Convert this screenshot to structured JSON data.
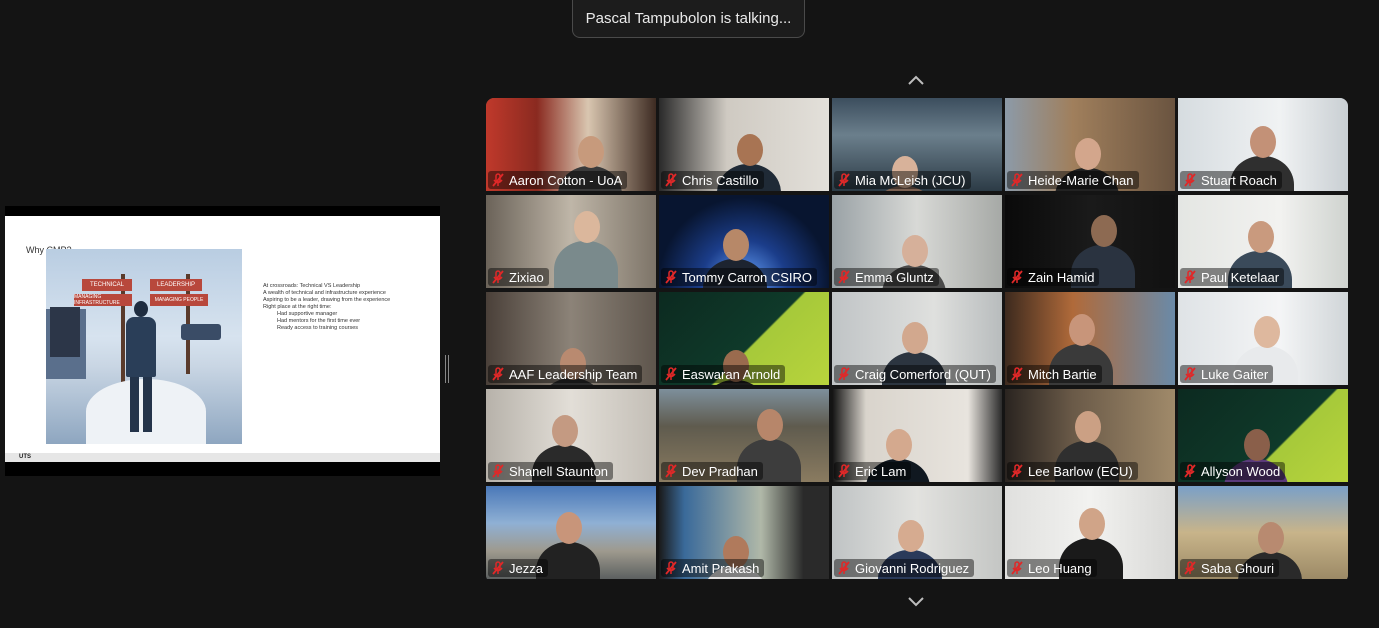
{
  "toast": {
    "text": "Pascal Tampubolon is talking..."
  },
  "slide": {
    "title": "Why CMP?",
    "signs": [
      "TECHNICAL",
      "LEADERSHIP",
      "MANAGING INFRASTRUCTURE",
      "MANAGING PEOPLE"
    ],
    "bullets": [
      "At crossroads: Technical VS Leadership",
      "A wealth of technical and infrastructure experience",
      "Aspiring to be a leader, drawing from the experience",
      "Right place at the right time:"
    ],
    "sub_bullets": [
      "Had supportive manager",
      "Had mentors for the first time ever",
      "Ready access to training courses"
    ],
    "footer": "UTS"
  },
  "nav": {
    "up_icon": "chevron-up-icon",
    "down_icon": "chevron-down-icon"
  },
  "colors": {
    "mic_muted": "#e02828",
    "background": "#141414"
  },
  "participants": [
    {
      "name": "Aaron Cotton - UoA"
    },
    {
      "name": "Chris Castillo"
    },
    {
      "name": "Mia McLeish (JCU)"
    },
    {
      "name": "Heide-Marie Chan"
    },
    {
      "name": "Stuart Roach"
    },
    {
      "name": "Zixiao"
    },
    {
      "name": "Tommy Carron CSIRO"
    },
    {
      "name": "Emma Gluntz"
    },
    {
      "name": "Zain Hamid"
    },
    {
      "name": "Paul Ketelaar"
    },
    {
      "name": "AAF Leadership Team"
    },
    {
      "name": "Easwaran Arnold"
    },
    {
      "name": "Craig Comerford (QUT)"
    },
    {
      "name": "Mitch Bartie"
    },
    {
      "name": "Luke Gaiter"
    },
    {
      "name": "Shanell Staunton"
    },
    {
      "name": "Dev Pradhan"
    },
    {
      "name": "Eric Lam"
    },
    {
      "name": "Lee Barlow (ECU)"
    },
    {
      "name": "Allyson Wood"
    },
    {
      "name": "Jezza"
    },
    {
      "name": "Amit Prakash"
    },
    {
      "name": "Giovanni Rodriguez"
    },
    {
      "name": "Leo Huang"
    },
    {
      "name": "Saba Ghouri"
    }
  ]
}
